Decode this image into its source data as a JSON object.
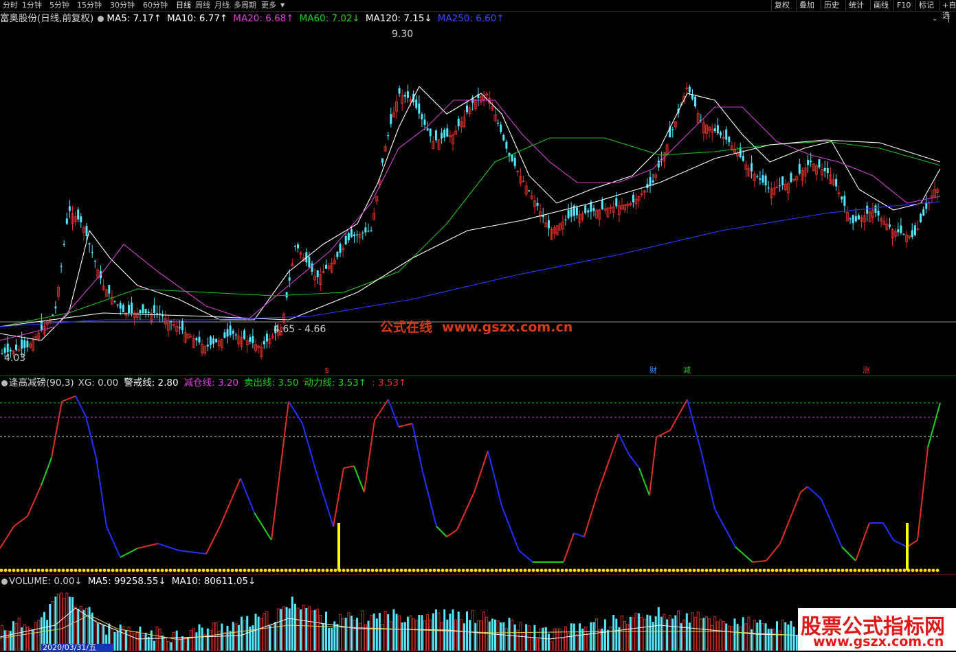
{
  "toolbar": {
    "periods": [
      "分时",
      "1分钟",
      "5分钟",
      "15分钟",
      "30分钟",
      "60分钟",
      "日线",
      "周线",
      "月线",
      "多周期",
      "更多"
    ],
    "active_period": "日线",
    "right_buttons": [
      "复权",
      "叠加",
      "历史",
      "统计",
      "画线",
      "F10",
      "标记",
      "+自选"
    ]
  },
  "main_legend": {
    "stock": "富奥股份(日线,前复权)",
    "items": [
      {
        "text": "MA5: 7.17↑",
        "color": "#ffffff"
      },
      {
        "text": "MA10: 6.77↑",
        "color": "#ffffff"
      },
      {
        "text": "MA20: 6.68↑",
        "color": "#e040e0"
      },
      {
        "text": "MA60: 7.02↓",
        "color": "#20d020"
      },
      {
        "text": "MA120: 7.15↓",
        "color": "#ffffff"
      },
      {
        "text": "MA250: 6.60↑",
        "color": "#2a3cff"
      }
    ]
  },
  "price_labels": {
    "high": "9.30",
    "low": "4.03",
    "range": "4.65 - 4.66"
  },
  "events": [
    {
      "text": "$",
      "color": "#e03030"
    },
    {
      "text": "财",
      "color": "#30a0ff"
    },
    {
      "text": "减",
      "color": "#30c030"
    },
    {
      "text": "涨",
      "color": "#e03030"
    }
  ],
  "watermark": {
    "cn": "公式在线",
    "url": "www.gszx.com.cn"
  },
  "indicator_legend": {
    "name": "逢高减磅(90,3)",
    "items": [
      {
        "text": "XG: 0.00",
        "color": "#d0d0d0"
      },
      {
        "text": "警戒线: 2.80",
        "color": "#ffffff"
      },
      {
        "text": "减仓线: 3.20",
        "color": "#e040e0"
      },
      {
        "text": "卖出线: 3.50",
        "color": "#20d020"
      },
      {
        "text": "动力线: 3.53↑",
        "color": "#20d020"
      },
      {
        "text": ": 3.53↑",
        "color": "#e03030"
      }
    ]
  },
  "volume_legend": {
    "name": "VOLUME: 0.00↓",
    "items": [
      {
        "text": "MA5: 99258.55↓",
        "color": "#ffffff"
      },
      {
        "text": "MA10: 80611.05↓",
        "color": "#ffffff"
      }
    ]
  },
  "date_cursor": "2020/03/31/五",
  "logo": {
    "line1": "股票公式指标网",
    "line2": "www.gszx.com.cn"
  },
  "colors": {
    "up": "#e0302a",
    "down": "#54e8ff",
    "ma5": "#ffffff",
    "ma20": "#d040d0",
    "ma60": "#20c020",
    "ma250": "#2a3cff"
  }
}
